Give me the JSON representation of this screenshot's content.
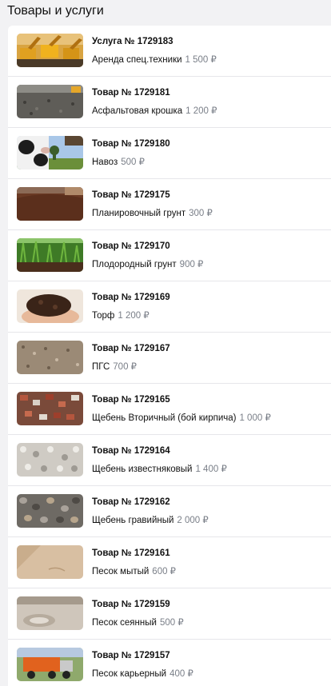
{
  "header": {
    "title": "Товары и услуги"
  },
  "items": [
    {
      "title": "Услуга № 1729183",
      "name": "Аренда спец.техники",
      "price": "1 500 ₽",
      "image_icon": "excavator-photo"
    },
    {
      "title": "Товар № 1729181",
      "name": "Асфальтовая крошка",
      "price": "1 200 ₽",
      "image_icon": "asphalt-crumb-photo"
    },
    {
      "title": "Товар № 1729180",
      "name": "Навоз",
      "price": "500 ₽",
      "image_icon": "cow-photo"
    },
    {
      "title": "Товар № 1729175",
      "name": "Планировочный грунт",
      "price": "300 ₽",
      "image_icon": "soil-pile-photo"
    },
    {
      "title": "Товар № 1729170",
      "name": "Плодородный грунт",
      "price": "900 ₽",
      "image_icon": "grass-soil-photo"
    },
    {
      "title": "Товар № 1729169",
      "name": "Торф",
      "price": "1 200 ₽",
      "image_icon": "peat-hands-photo"
    },
    {
      "title": "Товар № 1729167",
      "name": "ПГС",
      "price": "700 ₽",
      "image_icon": "gravel-sand-photo"
    },
    {
      "title": "Товар № 1729165",
      "name": "Щебень Вторичный (бой кирпича)",
      "price": "1 000 ₽",
      "image_icon": "brick-rubble-photo"
    },
    {
      "title": "Товар № 1729164",
      "name": "Щебень известняковый",
      "price": "1 400 ₽",
      "image_icon": "limestone-photo"
    },
    {
      "title": "Товар № 1729162",
      "name": "Щебень гравийный",
      "price": "2 000 ₽",
      "image_icon": "gravel-photo"
    },
    {
      "title": "Товар № 1729161",
      "name": "Песок мытый",
      "price": "600 ₽",
      "image_icon": "washed-sand-photo"
    },
    {
      "title": "Товар № 1729159",
      "name": "Песок сеянный",
      "price": "500 ₽",
      "image_icon": "sifted-sand-photo"
    },
    {
      "title": "Товар № 1729157",
      "name": "Песок карьерный",
      "price": "400 ₽",
      "image_icon": "dump-truck-photo"
    }
  ],
  "colors": {
    "background": "#f2f2f4",
    "card": "#ffffff",
    "divider": "#e6e6ea",
    "price": "#7a7f88"
  }
}
